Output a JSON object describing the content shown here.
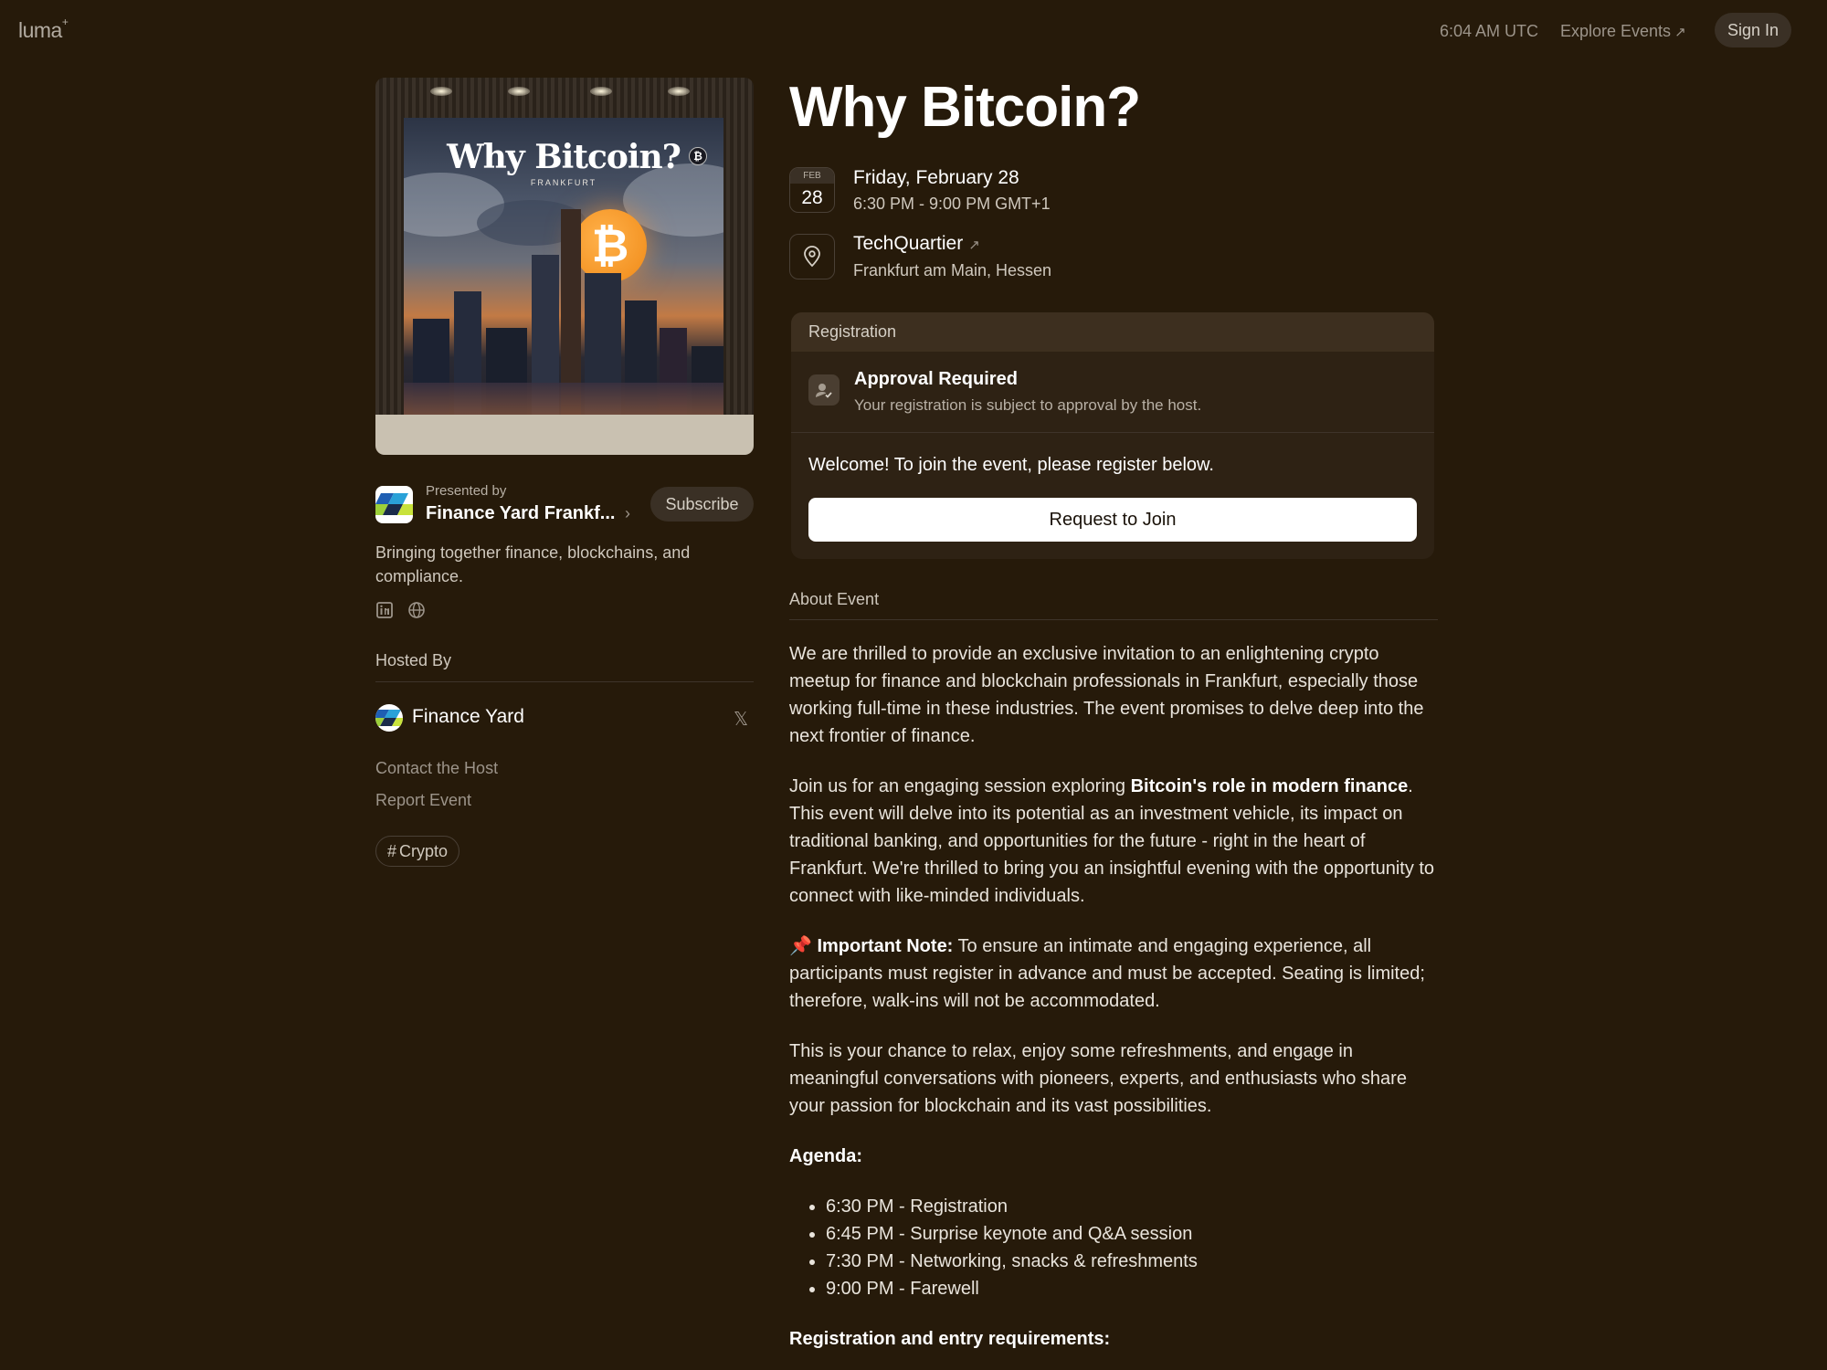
{
  "topbar": {
    "logo": "luma",
    "logo_mark": "+",
    "time": "6:04 AM UTC",
    "explore": "Explore Events",
    "explore_icon": "arrow-up-right-icon",
    "sign_in": "Sign In"
  },
  "cover": {
    "title": "Why Bitcoin?",
    "subtitle": "FRANKFURT",
    "coin_symbol": "₿",
    "small_coin": "B"
  },
  "presenter": {
    "label": "Presented by",
    "name": "Finance Yard Frankf...",
    "chevron": "›",
    "subscribe": "Subscribe",
    "description": "Bringing together finance, blockchains, and compliance.",
    "social": [
      "linkedin-icon",
      "globe-icon"
    ]
  },
  "hosted": {
    "label": "Hosted By",
    "host_name": "Finance Yard",
    "x_icon": "𝕏",
    "contact": "Contact the Host",
    "report": "Report Event",
    "tag_hash": "#",
    "tag": "Crypto"
  },
  "event": {
    "title": "Why Bitcoin?",
    "cal_month": "FEB",
    "cal_day": "28",
    "date": "Friday, February 28",
    "time": "6:30 PM - 9:00 PM GMT+1",
    "venue": "TechQuartier",
    "venue_ext": "↗",
    "city": "Frankfurt am Main, Hessen"
  },
  "registration": {
    "header": "Registration",
    "approval_title": "Approval Required",
    "approval_sub": "Your registration is subject to approval by the host.",
    "welcome": "Welcome! To join the event, please register below.",
    "button": "Request to Join"
  },
  "about": {
    "label": "About Event",
    "p1": "We are thrilled to provide an exclusive invitation to an enlightening crypto meetup for finance and blockchain professionals in Frankfurt, especially those working full-time in these industries. The event promises to delve deep into the next frontier of finance.",
    "p2_pre": "Join us for an engaging session exploring ",
    "p2_bold": "Bitcoin's role in modern finance",
    "p2_post": ". This event will delve into its potential as an investment vehicle, its impact on traditional banking, and opportunities for the future - right in the heart of Frankfurt. We're thrilled to bring you an insightful evening with the opportunity to connect with like-minded individuals.",
    "p3_emoji": "📌",
    "p3_bold": "Important Note:",
    "p3_post": " To ensure an intimate and engaging experience, all participants must register in advance and must be accepted. Seating is limited; therefore, walk-ins will not be accommodated.",
    "p4": "This is your chance to relax, enjoy some refreshments, and engage in meaningful conversations with pioneers, experts, and enthusiasts who share your passion for blockchain and its vast possibilities.",
    "agenda_label": "Agenda:",
    "agenda": [
      "6:30 PM - Registration",
      "6:45 PM - Surprise keynote and Q&A session",
      "7:30 PM - Networking, snacks & refreshments",
      "9:00 PM - Farewell"
    ],
    "req_label": "Registration and entry requirements:"
  },
  "colors": {
    "background": "#261a0a",
    "card": "#2e2214",
    "muted": "#9c948a",
    "bitcoin": "#f08a17"
  }
}
